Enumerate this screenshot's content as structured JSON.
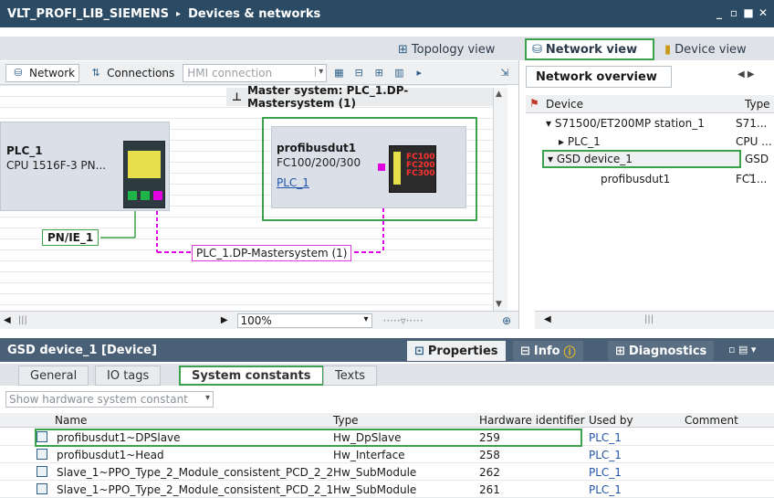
{
  "window": {
    "project": "VLT_PROFI_LIB_SIEMENS",
    "separator": "▸",
    "section": "Devices & networks"
  },
  "views": {
    "topology": "Topology view",
    "network": "Network view",
    "device": "Device view"
  },
  "toolbar": {
    "network": "Network",
    "connections": "Connections",
    "hmi_connection": "HMI connection"
  },
  "canvas": {
    "master_system": "Master system: PLC_1.DP-Mastersystem (1)",
    "plc": {
      "name": "PLC_1",
      "type": "CPU 1516F-3 PN..."
    },
    "slave": {
      "name": "profibusdut1",
      "type": "FC100/200/300",
      "link": "PLC_1",
      "logo_lines": [
        "FC100",
        "FC200",
        "FC300"
      ]
    },
    "pnie": "PN/IE_1",
    "dp_system": "PLC_1.DP-Mastersystem (1)",
    "zoom": "100%"
  },
  "overview": {
    "tab": "Network overview",
    "headers": {
      "device": "Device",
      "type": "Type"
    },
    "rows": [
      {
        "name": "S71500/ET200MP station_1",
        "type": "S71...",
        "indent": 1,
        "expander": "▾"
      },
      {
        "name": "PLC_1",
        "type": "CPU ...",
        "indent": 2,
        "expander": "▸"
      },
      {
        "name": "GSD device_1",
        "type": "GSD ...",
        "indent": 1,
        "expander": "▾"
      },
      {
        "name": "profibusdut1",
        "type": "FC1...",
        "indent": 3,
        "expander": ""
      }
    ]
  },
  "properties": {
    "title": "GSD device_1 [Device]",
    "tabs": {
      "properties": "Properties",
      "info": "Info",
      "diagnostics": "Diagnostics"
    },
    "subtabs": [
      "General",
      "IO tags",
      "System constants",
      "Texts"
    ],
    "filter": "Show hardware system constant",
    "headers": {
      "name": "Name",
      "type": "Type",
      "hwid": "Hardware identifier",
      "used_by": "Used by",
      "comment": "Comment"
    },
    "rows": [
      {
        "name": "profibusdut1~DPSlave",
        "type": "Hw_DpSlave",
        "hwid": "259",
        "used_by": "PLC_1"
      },
      {
        "name": "profibusdut1~Head",
        "type": "Hw_Interface",
        "hwid": "258",
        "used_by": "PLC_1"
      },
      {
        "name": "Slave_1~PPO_Type_2_Module_consistent_PCD_2_2",
        "type": "Hw_SubModule",
        "hwid": "262",
        "used_by": "PLC_1"
      },
      {
        "name": "Slave_1~PPO_Type_2_Module_consistent_PCD_2_1",
        "type": "Hw_SubModule",
        "hwid": "261",
        "used_by": "PLC_1"
      }
    ]
  }
}
